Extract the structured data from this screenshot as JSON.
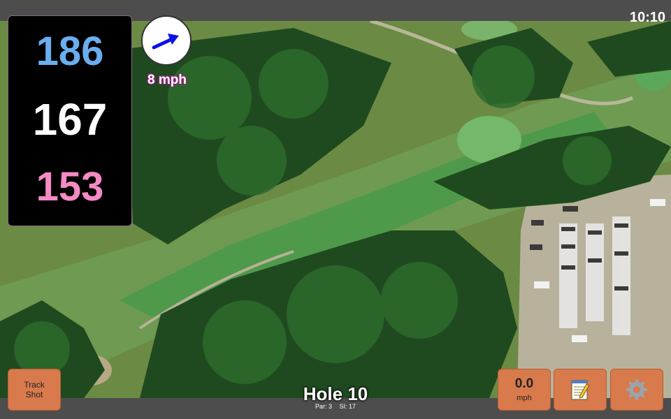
{
  "status_bar": {
    "time": "10:10"
  },
  "distances": {
    "back": "186",
    "middle": "167",
    "front": "153",
    "colors": {
      "back": "#6aaef0",
      "middle": "#ffffff",
      "front": "#f58ac4"
    }
  },
  "wind": {
    "speed": "8 mph",
    "arrow_color": "#0a12e8",
    "icon": "wind-direction-arrow-icon"
  },
  "buttons": {
    "track_shot": {
      "line1": "Track",
      "line2": "Shot"
    },
    "speed": {
      "value": "0.0",
      "unit": "mph"
    },
    "notes": {
      "icon": "notepad-icon"
    },
    "settings": {
      "icon": "gear-icon"
    }
  },
  "hole": {
    "title": "Hole 10",
    "par": "Par: 3",
    "stroke_index": "SI: 17"
  },
  "colors": {
    "button_bg": "#d87a4c",
    "bar_bg": "#4d4d4d",
    "panel_bg": "#000000"
  }
}
